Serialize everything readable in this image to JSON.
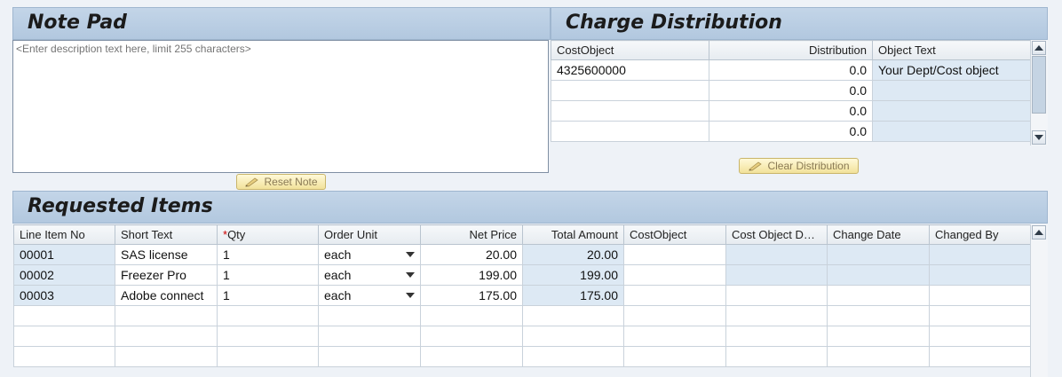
{
  "notepad": {
    "title": "Note Pad",
    "placeholder": "<Enter description text here, limit 255 characters>",
    "reset_label": "Reset Note"
  },
  "charge": {
    "title": "Charge Distribution",
    "headers": [
      "CostObject",
      "Distribution",
      "Object Text"
    ],
    "rows": [
      {
        "cost_object": "4325600000",
        "distribution": "0.0",
        "object_text": "Your Dept/Cost object"
      },
      {
        "cost_object": "",
        "distribution": "0.0",
        "object_text": ""
      },
      {
        "cost_object": "",
        "distribution": "0.0",
        "object_text": ""
      },
      {
        "cost_object": "",
        "distribution": "0.0",
        "object_text": ""
      }
    ],
    "clear_label": "Clear Distribution"
  },
  "items": {
    "title": "Requested Items",
    "headers": {
      "line_item_no": "Line Item No",
      "short_text": "Short Text",
      "qty_required_mark": "*",
      "qty": "Qty",
      "order_unit": "Order Unit",
      "net_price": "Net Price",
      "total_amount": "Total Amount",
      "cost_object": "CostObject",
      "cost_object_desc": "Cost Object D…",
      "change_date": "Change Date",
      "changed_by": "Changed By"
    },
    "rows": [
      {
        "line": "00001",
        "short_text": "SAS license",
        "qty": "1",
        "unit": "each",
        "net_price": "20.00",
        "total": "20.00"
      },
      {
        "line": "00002",
        "short_text": "Freezer Pro",
        "qty": "1",
        "unit": "each",
        "net_price": "199.00",
        "total": "199.00"
      },
      {
        "line": "00003",
        "short_text": "Adobe connect",
        "qty": "1",
        "unit": "each",
        "net_price": "175.00",
        "total": "175.00"
      }
    ]
  }
}
